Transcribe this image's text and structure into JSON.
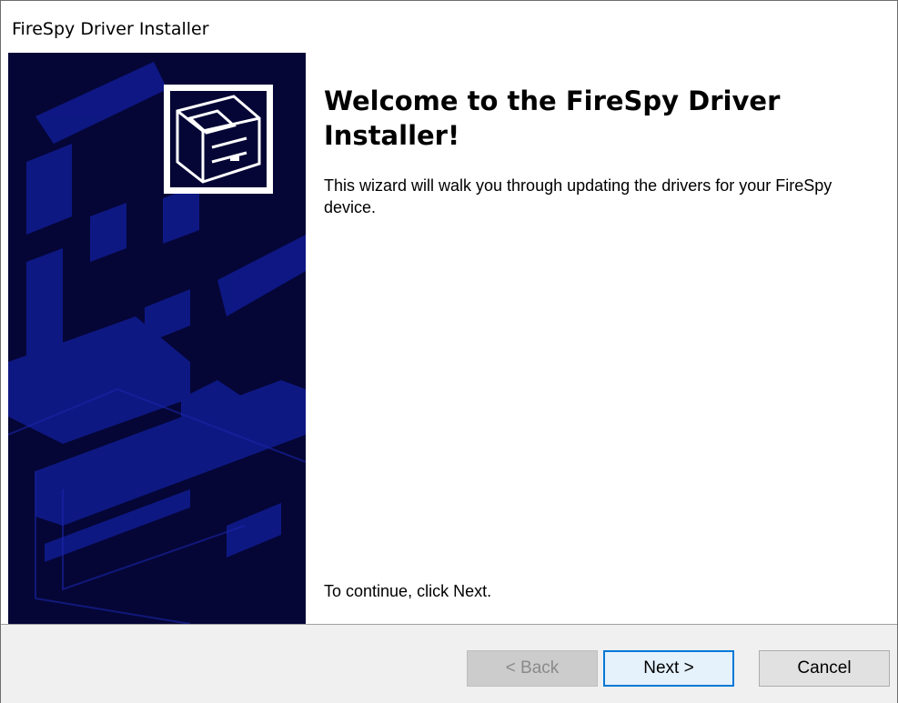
{
  "window": {
    "title": "FireSpy Driver Installer"
  },
  "content": {
    "heading": "Welcome to the FireSpy Driver Installer!",
    "description": "This wizard will walk you through updating the drivers for your FireSpy device.",
    "continue_hint": "To continue, click Next."
  },
  "buttons": {
    "back": {
      "label": "< Back",
      "enabled": false
    },
    "next": {
      "label": "Next >",
      "enabled": true,
      "default": true
    },
    "cancel": {
      "label": "Cancel",
      "enabled": true
    }
  },
  "colors": {
    "sidebar_bg": "#050636",
    "sidebar_art": "#101a8c",
    "footer_bg": "#f0f0f0",
    "default_button_border": "#0078d7"
  },
  "icons": {
    "wizard_logo": "hardware-drive-icon",
    "sidebar_art": "circuit-board-illustration"
  }
}
